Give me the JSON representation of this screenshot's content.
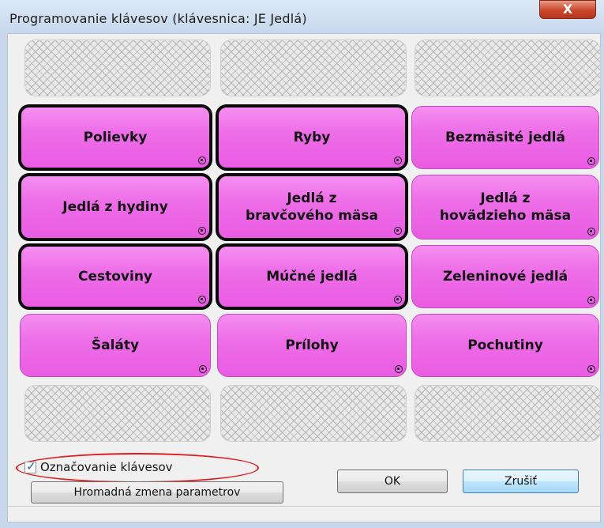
{
  "window": {
    "title": "Programovanie klávesov (klávesnica: JE  Jedlá)",
    "close_glyph": "X"
  },
  "keys": [
    {
      "label": "",
      "type": "empty"
    },
    {
      "label": "",
      "type": "empty"
    },
    {
      "label": "",
      "type": "empty"
    },
    {
      "label": "Polievky",
      "type": "pink",
      "bold": true
    },
    {
      "label": "Ryby",
      "type": "pink",
      "bold": true
    },
    {
      "label": "Bezmäsité jedlá",
      "type": "pink",
      "bold": false
    },
    {
      "label": "Jedlá z hydiny",
      "type": "pink",
      "bold": true
    },
    {
      "label": "Jedlá z\nbravčového mäsa",
      "type": "pink",
      "bold": true
    },
    {
      "label": "Jedlá z\nhovädzieho mäsa",
      "type": "pink",
      "bold": false
    },
    {
      "label": "Cestoviny",
      "type": "pink",
      "bold": true
    },
    {
      "label": "Múčné jedlá",
      "type": "pink",
      "bold": true
    },
    {
      "label": "Zeleninové jedlá",
      "type": "pink",
      "bold": false
    },
    {
      "label": "Šaláty",
      "type": "pink",
      "bold": false
    },
    {
      "label": "Prílohy",
      "type": "pink",
      "bold": false
    },
    {
      "label": "Pochutiny",
      "type": "pink",
      "bold": false
    },
    {
      "label": "",
      "type": "empty"
    },
    {
      "label": "",
      "type": "empty"
    },
    {
      "label": "",
      "type": "empty"
    }
  ],
  "options": {
    "oznacovanie_label": "Označovanie klávesov",
    "oznacovanie_checked": true
  },
  "buttons": {
    "hromadna": "Hromadná zmena parametrov",
    "ok": "OK",
    "zrusit": "Zrušiť"
  },
  "colors": {
    "key_pink": "#ee6ee8",
    "highlight_oval": "#e11b1b"
  }
}
